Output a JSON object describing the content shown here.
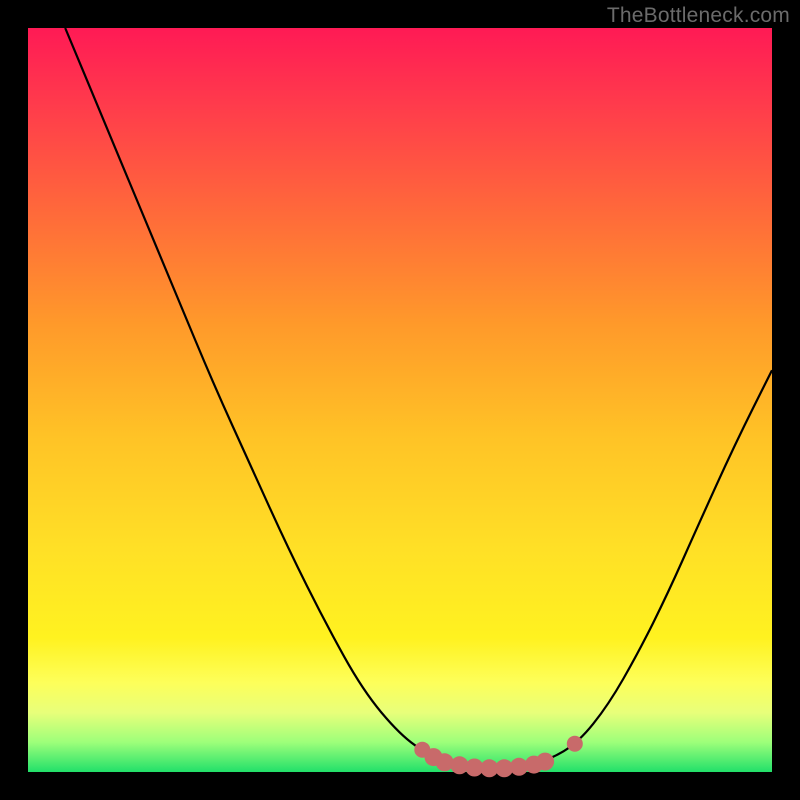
{
  "watermark": "TheBottleneck.com",
  "colors": {
    "curve_stroke": "#000000",
    "curve_fill": "none",
    "marker_stroke": "#c86a6a",
    "marker_fill": "#c86a6a",
    "background_black": "#000000",
    "gradient_top": "#ff1a55",
    "gradient_bottom": "#22e06a"
  },
  "chart_data": {
    "type": "line",
    "title": "",
    "xlabel": "",
    "ylabel": "",
    "xlim": [
      0,
      100
    ],
    "ylim": [
      0,
      100
    ],
    "grid": false,
    "legend": false,
    "curve": [
      {
        "x": 5.0,
        "y": 100.0
      },
      {
        "x": 10.0,
        "y": 88.0
      },
      {
        "x": 15.0,
        "y": 76.0
      },
      {
        "x": 20.0,
        "y": 64.0
      },
      {
        "x": 25.0,
        "y": 52.0
      },
      {
        "x": 30.0,
        "y": 41.0
      },
      {
        "x": 35.0,
        "y": 30.0
      },
      {
        "x": 40.0,
        "y": 20.0
      },
      {
        "x": 45.0,
        "y": 11.0
      },
      {
        "x": 50.0,
        "y": 5.0
      },
      {
        "x": 54.0,
        "y": 2.2
      },
      {
        "x": 58.0,
        "y": 0.9
      },
      {
        "x": 62.0,
        "y": 0.5
      },
      {
        "x": 66.0,
        "y": 0.7
      },
      {
        "x": 70.0,
        "y": 1.6
      },
      {
        "x": 74.0,
        "y": 4.0
      },
      {
        "x": 78.0,
        "y": 9.0
      },
      {
        "x": 82.0,
        "y": 16.0
      },
      {
        "x": 86.0,
        "y": 24.0
      },
      {
        "x": 90.0,
        "y": 33.0
      },
      {
        "x": 95.0,
        "y": 44.0
      },
      {
        "x": 100.0,
        "y": 54.0
      }
    ],
    "markers": [
      {
        "x": 53.0,
        "y": 3.0
      },
      {
        "x": 54.5,
        "y": 2.0
      },
      {
        "x": 56.0,
        "y": 1.3
      },
      {
        "x": 58.0,
        "y": 0.9
      },
      {
        "x": 60.0,
        "y": 0.6
      },
      {
        "x": 62.0,
        "y": 0.5
      },
      {
        "x": 64.0,
        "y": 0.5
      },
      {
        "x": 66.0,
        "y": 0.7
      },
      {
        "x": 68.0,
        "y": 1.0
      },
      {
        "x": 69.5,
        "y": 1.4
      },
      {
        "x": 73.5,
        "y": 3.8
      }
    ]
  }
}
